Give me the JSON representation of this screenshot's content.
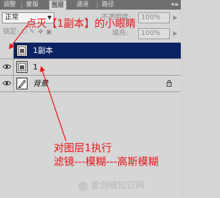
{
  "panel": {
    "tabs": [
      {
        "label": "调整",
        "active": false
      },
      {
        "label": "蒙版",
        "active": false
      },
      {
        "label": "图层",
        "active": true
      },
      {
        "label": "通道",
        "active": false
      },
      {
        "label": "路径",
        "active": false
      }
    ],
    "menu_icon": "panel-menu-icon"
  },
  "controls": {
    "blend_mode": "正常",
    "opacity_label": "不透明度:",
    "opacity_value": "100%",
    "lock_label": "锁定:",
    "fill_label": "填充:",
    "fill_value": "100%"
  },
  "layers": [
    {
      "name": "1副本",
      "selected": true,
      "visible": false,
      "thumb_icon": "layer-thumbnail-icon"
    },
    {
      "name": "1",
      "selected": false,
      "visible": true,
      "thumb_icon": "layer-thumbnail-icon"
    },
    {
      "name": "背景",
      "selected": false,
      "visible": true,
      "locked": true,
      "thumb_icon": "background-brush-icon"
    }
  ],
  "annotations": {
    "top": "点灭【1副本】的小眼睛",
    "bottom_line1": "对图层1执行",
    "bottom_line2": "滤镜---模糊---高斯模糊",
    "color": "#e8161b"
  },
  "watermark": {
    "text": "爱创根知识网"
  }
}
